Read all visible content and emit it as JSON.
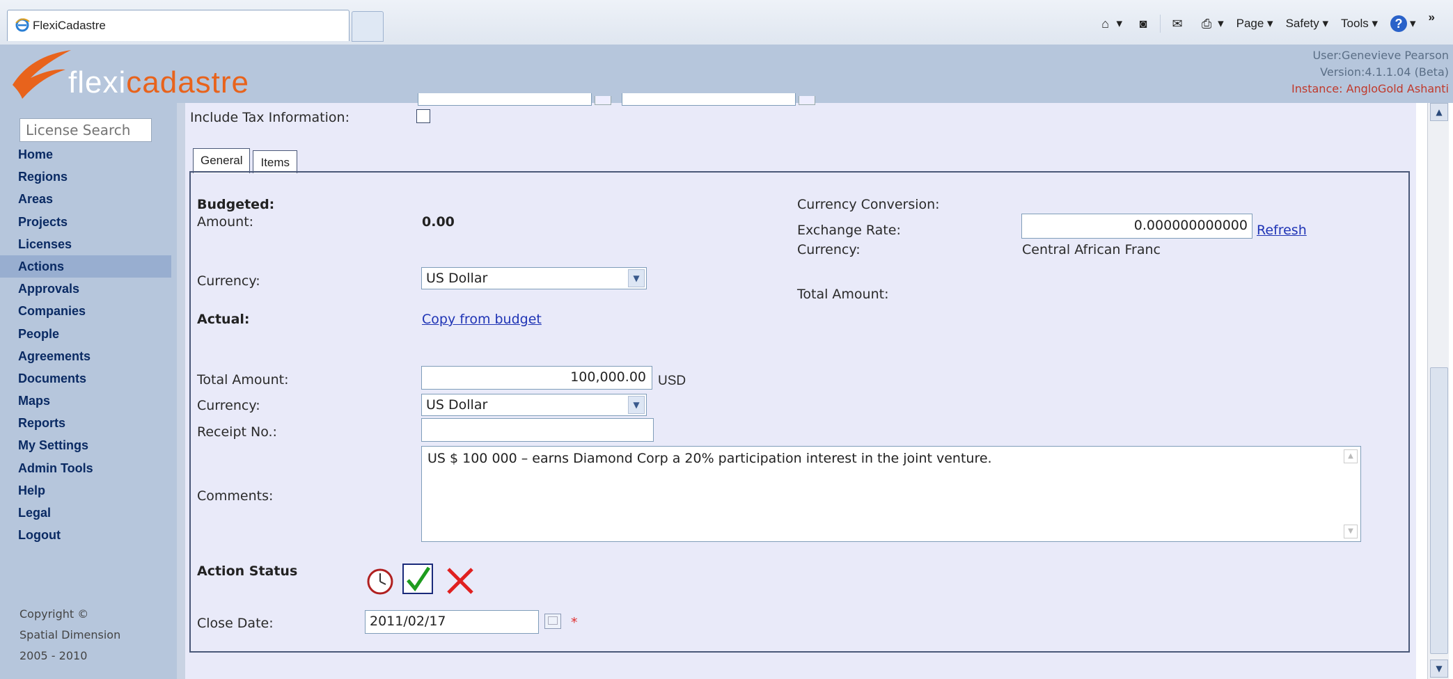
{
  "browser": {
    "tab_title": "FlexiCadastre",
    "commands": {
      "page": "Page ▾",
      "safety": "Safety ▾",
      "tools": "Tools ▾",
      "overflow": "»"
    }
  },
  "header": {
    "logo_text": {
      "part1": "flexi",
      "part2": "cadastre"
    },
    "user": "User:Genevieve Pearson",
    "version": "Version:4.1.1.04 (Beta)",
    "instance": "Instance: AngloGold Ashanti"
  },
  "sidebar": {
    "search_placeholder": "License Search",
    "items": [
      "Home",
      "Regions",
      "Areas",
      "Projects",
      "Licenses",
      "Actions",
      "Approvals",
      "Companies",
      "People",
      "Agreements",
      "Documents",
      "Maps",
      "Reports",
      "My Settings",
      "Admin Tools",
      "Help",
      "Legal",
      "Logout"
    ],
    "active": "Actions",
    "copyright": [
      "Copyright ©",
      "Spatial Dimension",
      "2005 - 2010"
    ]
  },
  "form": {
    "include_tax_label": "Include Tax Information:",
    "tabs": [
      "General",
      "Items"
    ],
    "budgeted_heading": "Budgeted:",
    "amount_label": "Amount:",
    "amount_value": "0.00",
    "currency_label": "Currency:",
    "budget_currency": "US Dollar",
    "actual_heading": "Actual:",
    "copy_link": "Copy from budget",
    "total_amount_label": "Total Amount:",
    "total_amount_value": "100,000.00",
    "total_amount_unit": "USD",
    "actual_currency": "US Dollar",
    "receipt_label": "Receipt No.:",
    "receipt_value": "",
    "comments_label": "Comments:",
    "comments_value": "US $ 100 000 – earns Diamond Corp a 20% participation interest in the joint venture.",
    "action_status_label": "Action Status",
    "close_date_label": "Close Date:",
    "close_date_value": "2011/02/17",
    "required_marker": "*",
    "conversion": {
      "heading": "Currency Conversion:",
      "rate_label": "Exchange Rate:",
      "rate_value": "0.000000000000",
      "refresh_link": "Refresh",
      "currency_label": "Currency:",
      "currency_value": "Central African Franc",
      "total_label": "Total Amount:"
    }
  }
}
